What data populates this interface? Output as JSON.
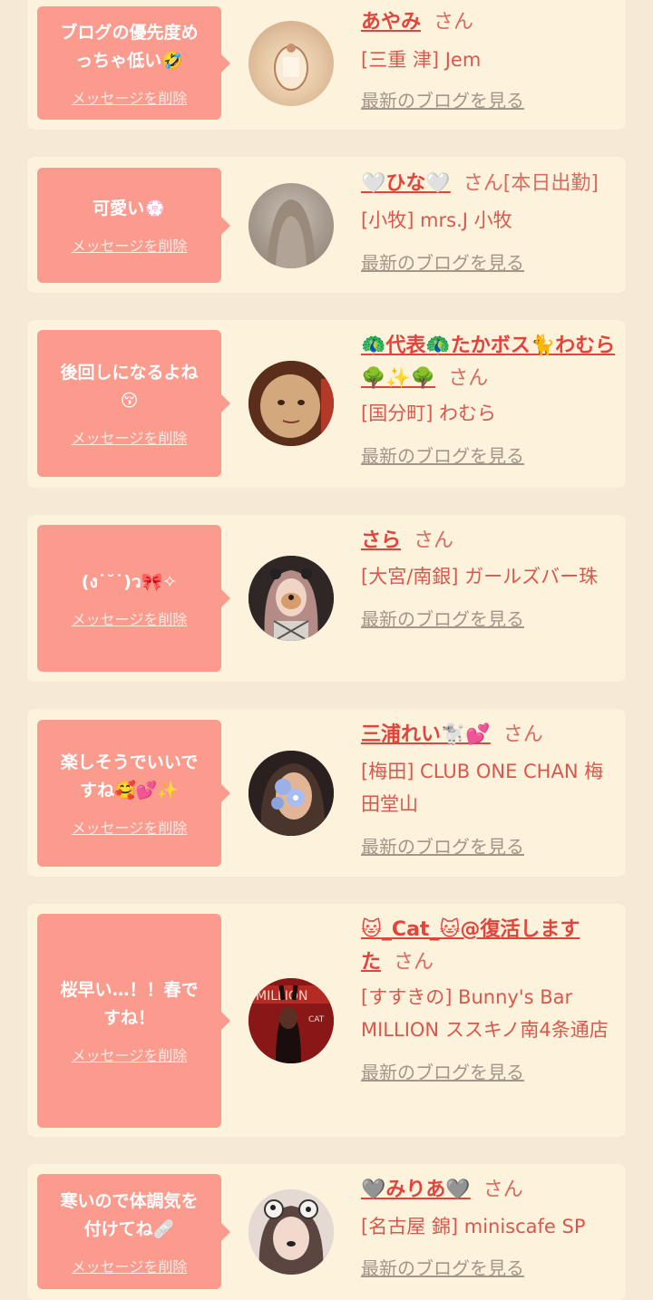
{
  "entries": [
    {
      "message": "ブログの優先度め\nっちゃ低い🤣",
      "delete_label": "メッセージを削除",
      "name": "あやみ",
      "san": "さん",
      "shop": "[三重 津] Jem",
      "latest_label": "最新のブログを見る"
    },
    {
      "message": "可愛い💮",
      "delete_label": "メッセージを削除",
      "name": "🤍ひな🤍",
      "san": "さん[本日出勤]",
      "shop": "[小牧] mrs.J 小牧",
      "latest_label": "最新のブログを見る"
    },
    {
      "message": "後回しになるよね\n😚",
      "delete_label": "メッセージを削除",
      "name": "🦚代表🦚たかボス🐈わむら🌳✨🌳",
      "san": "さん",
      "shop": "[国分町] わむら",
      "latest_label": "最新のブログを見る"
    },
    {
      "message": "(ง˙˘˙)ว🎀✧",
      "delete_label": "メッセージを削除",
      "name": "さら",
      "san": "さん",
      "shop": "[大宮/南銀] ガールズバー珠",
      "latest_label": "最新のブログを見る"
    },
    {
      "message": "楽しそうでいいで\nすね🥰💕✨",
      "delete_label": "メッセージを削除",
      "name": "三浦れい🐩💕",
      "san": "さん",
      "shop": "[梅田] CLUB ONE CHAN 梅田堂山",
      "latest_label": "最新のブログを見る"
    },
    {
      "message": "桜早い…！！春で\nすね！",
      "delete_label": "メッセージを削除",
      "name": "🐱_Cat_🐱@復活しますた",
      "san": "さん",
      "shop": "[すすきの] Bunny's Bar MILLION ススキノ南4条通店",
      "latest_label": "最新のブログを見る"
    },
    {
      "message": "寒いので体調気を\n付けてね🩹",
      "delete_label": "メッセージを削除",
      "name": "🩶みりあ🩶",
      "san": "さん",
      "shop": "[名古屋 錦] miniscafe SP",
      "latest_label": "最新のブログを見る"
    }
  ],
  "colors": {
    "background": "#f6ead6",
    "card": "#fdf2dc",
    "bubble": "#fb9b8e",
    "name": "#e2443c",
    "link_gray": "#a59588"
  }
}
